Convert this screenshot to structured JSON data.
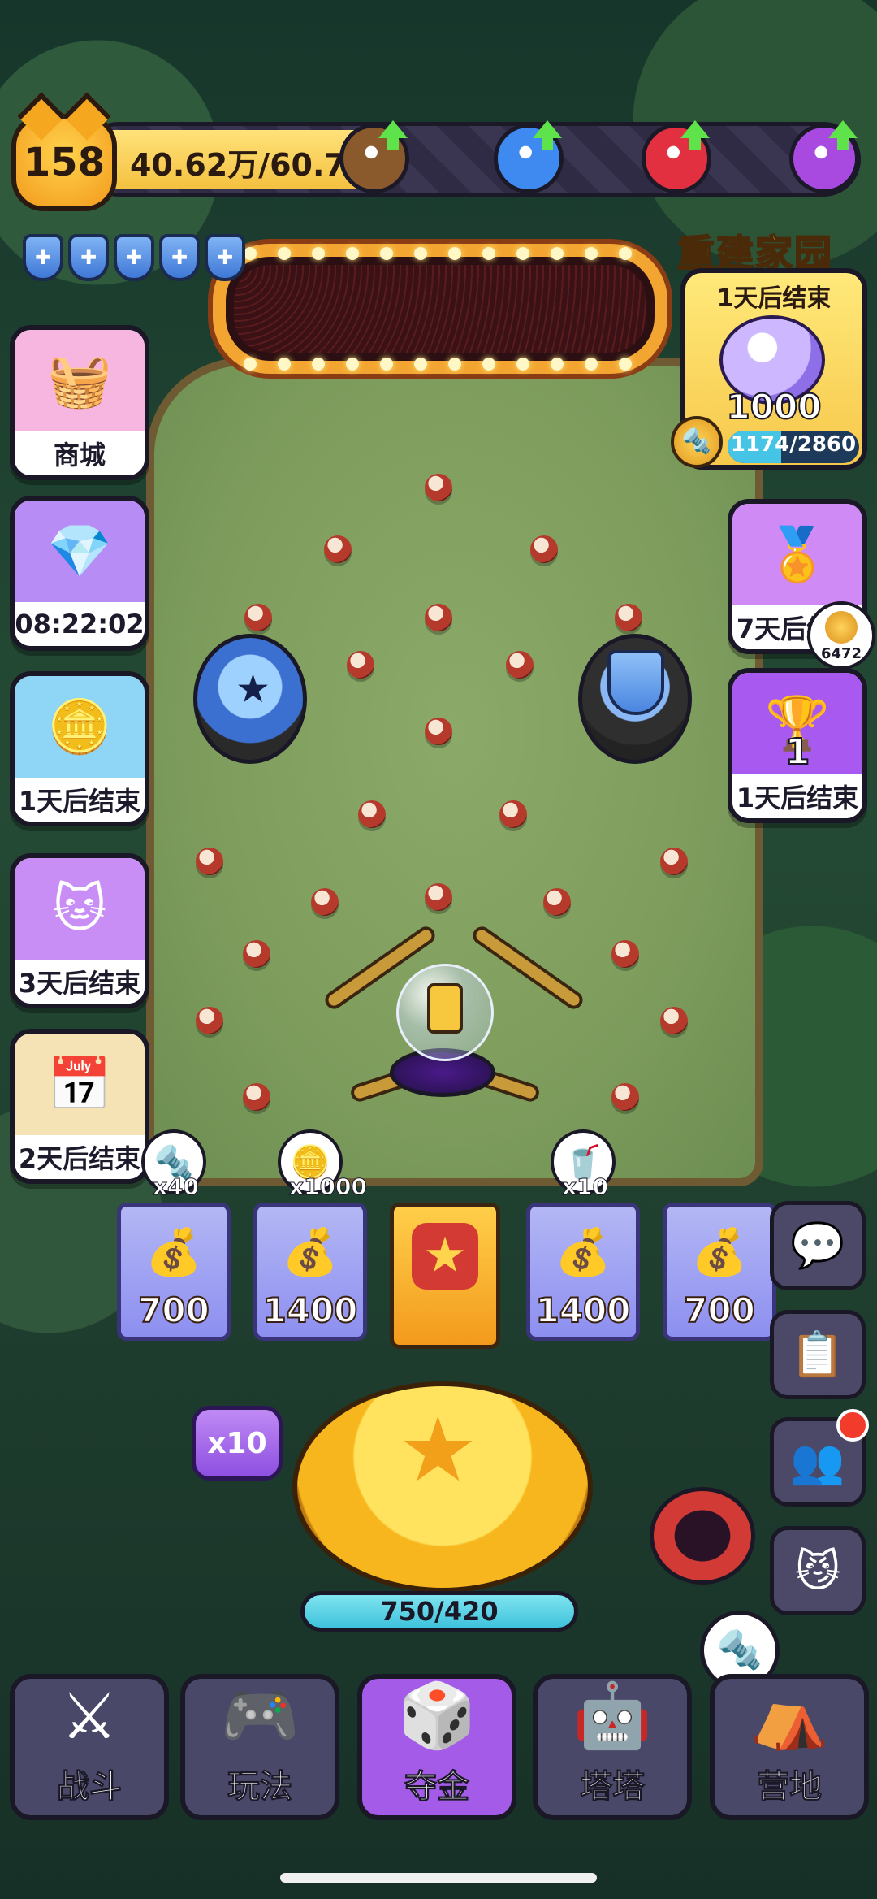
{
  "player": {
    "level": "158",
    "xp_text": "40.62万/60.77万",
    "xp_fraction": 0.668
  },
  "resources": [
    {
      "icon": "coin-bag-icon",
      "color": "#8a5a2c"
    },
    {
      "icon": "water-drop-icon",
      "color": "#3f8af0"
    },
    {
      "icon": "fire-icon",
      "color": "#e23040"
    },
    {
      "icon": "level-up-icon",
      "color": "#a84ae0"
    }
  ],
  "shields": {
    "count": 5,
    "icon": "shield-icon",
    "color": "#5e98ea"
  },
  "left_tiles": [
    {
      "name": "shop",
      "label": "商城",
      "icon": "shopping-basket-icon",
      "glyph": "🧺",
      "bg": "#f7b6e0"
    },
    {
      "name": "gem-bag",
      "label": "08:22:02",
      "icon": "gem-bag-icon",
      "glyph": "💎",
      "bg": "#b88cf5"
    },
    {
      "name": "coin-event",
      "label": "1天后结束",
      "icon": "coin-icon",
      "glyph": "🪙",
      "bg": "#8fd5f5"
    },
    {
      "name": "golden-cats",
      "label": "3天后结束",
      "icon": "golden-cat-icon",
      "glyph": "🐱",
      "bg": "#c98ef5"
    },
    {
      "name": "calendar",
      "label": "2天后结束",
      "icon": "calendar-icon",
      "glyph": "📅",
      "bg": "#f5e2b5"
    }
  ],
  "event": {
    "title": "重建家园",
    "subtitle": "1天后结束",
    "reward_value": "1000",
    "progress_text": "1174/2860",
    "progress_fraction": 0.41
  },
  "right_tiles": [
    {
      "name": "cat-medal",
      "label": "7天后结束",
      "icon": "cat-medal-icon",
      "glyph": "🏅",
      "bg": "#d08af5"
    },
    {
      "name": "trophy",
      "label": "1天后结束",
      "icon": "trophy-icon",
      "glyph": "🏆",
      "bg": "#a85af0",
      "rank": "1",
      "badge": "6472"
    }
  ],
  "slots": [
    {
      "value": "700",
      "bubble_count": "x40",
      "bubble_icon": "screw-icon",
      "bubble_glyph": "🔩"
    },
    {
      "value": "1400",
      "bubble_count": "x1000",
      "bubble_icon": "coin-icon",
      "bubble_glyph": "🪙"
    },
    {
      "value": "",
      "center": true,
      "icon": "mystery-star-icon"
    },
    {
      "value": "1400",
      "bubble_count": "x10",
      "bubble_icon": "energy-drink-icon",
      "bubble_glyph": "🥤"
    },
    {
      "value": "700"
    }
  ],
  "right_buttons": [
    {
      "name": "chat",
      "icon": "chat-icon",
      "glyph": "💬"
    },
    {
      "name": "tasks",
      "icon": "clipboard-check-icon",
      "glyph": "📋"
    },
    {
      "name": "friends",
      "icon": "friends-icon",
      "glyph": "👥",
      "dot": true
    },
    {
      "name": "cat-badge",
      "icon": "cat-badge-icon",
      "glyph": "😼"
    }
  ],
  "play": {
    "multiplier": "x10",
    "energy_text": "750/420"
  },
  "nav": [
    {
      "label": "战斗",
      "icon": "crossed-swords-icon",
      "glyph": "⚔"
    },
    {
      "label": "玩法",
      "icon": "gamepad-icon",
      "glyph": "🎮"
    },
    {
      "label": "夺金",
      "icon": "dice-faces-icon",
      "glyph": "🎲",
      "active": true
    },
    {
      "label": "塔塔",
      "icon": "cat-robot-icon",
      "glyph": "🤖"
    },
    {
      "label": "营地",
      "icon": "tent-icon",
      "glyph": "⛺"
    }
  ]
}
